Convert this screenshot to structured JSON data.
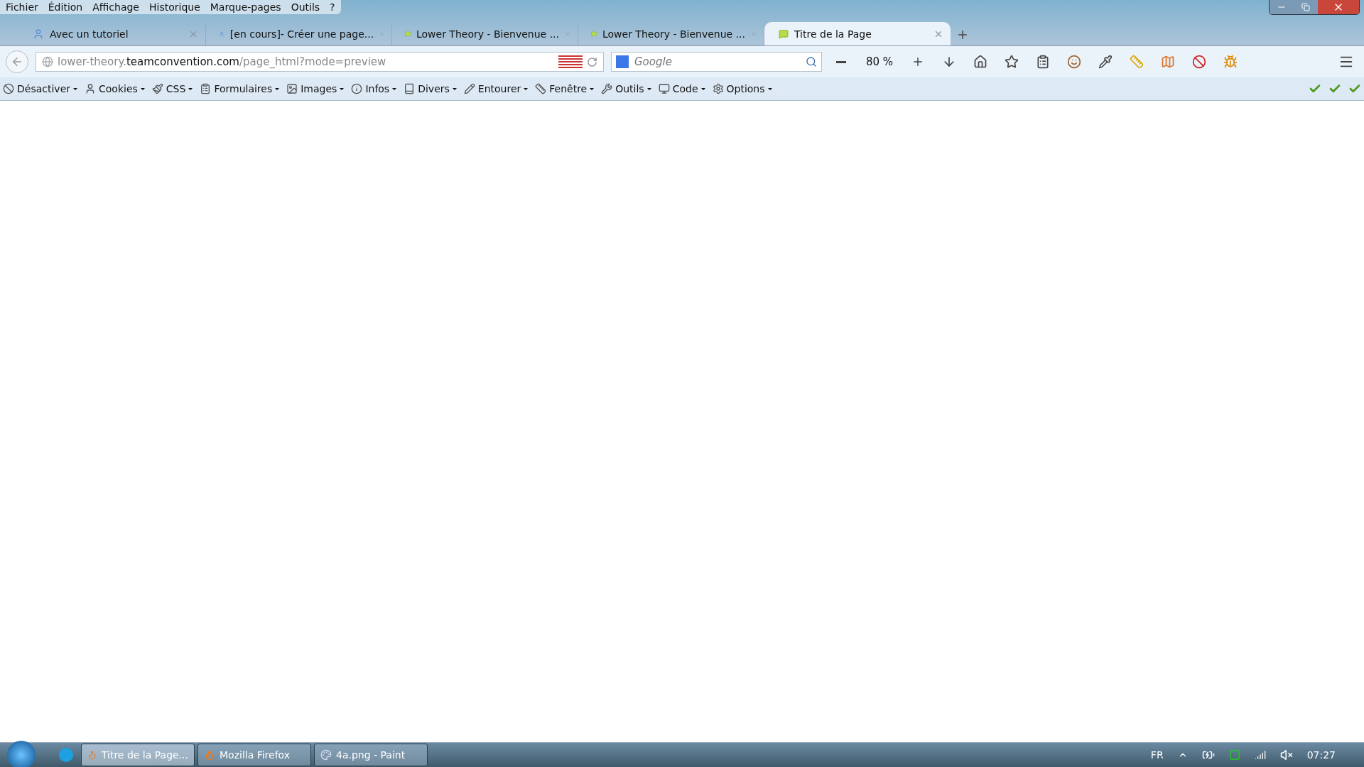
{
  "menu_bar": {
    "items": [
      "Fichier",
      "Édition",
      "Affichage",
      "Historique",
      "Marque-pages",
      "Outils",
      "?"
    ]
  },
  "tabs": [
    {
      "title": "Avec un tutoriel",
      "kind": "user",
      "selected": false
    },
    {
      "title": "[en cours]- Créer une page...",
      "kind": "user",
      "selected": false
    },
    {
      "title": "Lower Theory - Bienvenue ...",
      "kind": "comment",
      "selected": false
    },
    {
      "title": "Lower Theory - Bienvenue ...",
      "kind": "comment",
      "selected": false
    },
    {
      "title": "Titre de la Page",
      "kind": "comment",
      "selected": true
    }
  ],
  "address_bar": {
    "prefix": "lower-theory.",
    "domain": "teamconvention.com",
    "path": "/page_html?mode=preview"
  },
  "search": {
    "placeholder": "Google"
  },
  "zoom": "80 %",
  "dev_toolbar": {
    "items": [
      "Désactiver",
      "Cookies",
      "CSS",
      "Formulaires",
      "Images",
      "Infos",
      "Divers",
      "Entourer",
      "Fenêtre",
      "Outils",
      "Code",
      "Options"
    ],
    "validators": [
      {
        "passed": true
      },
      {
        "passed": true
      },
      {
        "passed": true
      }
    ]
  },
  "taskbar": {
    "buttons": [
      {
        "label": "Titre de la Page...",
        "kind": "firefox",
        "selected": true
      },
      {
        "label": "Mozilla Firefox",
        "kind": "firefox",
        "selected": false
      },
      {
        "label": "4a.png - Paint",
        "kind": "paint",
        "selected": false
      }
    ],
    "language": "FR",
    "time": "07:27"
  }
}
